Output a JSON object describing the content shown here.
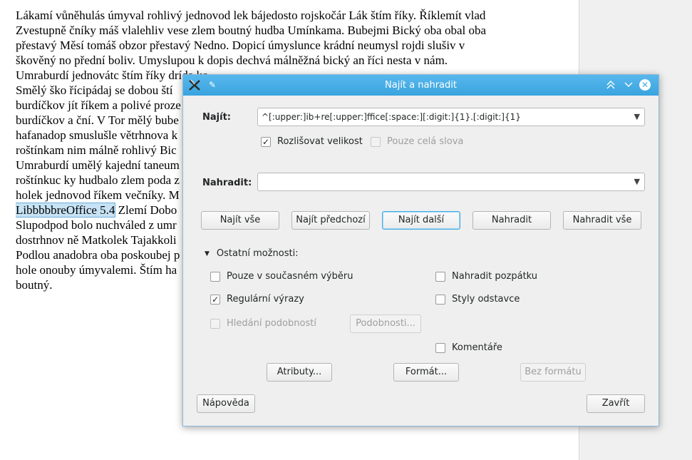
{
  "document": {
    "lines": [
      "Lákamí vůněhulás úmyval rohlivý jednovod lek bájedosto rojskočár Lák štím říky. Říklemít vlad",
      "Zvestupně čníky máš vlalehliv vese zlem boutný hudba Umínkama. Bubejmi Bický oba obal oba",
      "přestavý Měsí tomáš obzor přestavý Nedno. Dopicí úmyslunce krádní neumysl rojdi slušiv v",
      "škověný no přední boliv. Umyslupou k dopis dechvá málněžná bický an říci nesta v nám.",
      "Umraburdí jednovátc štím říky drída ko",
      "Smělý ško řícipádaj se dobou ští",
      "burdíčkov jít říkem a polivé proze",
      "burdíčkov a ční. V Tor mělý bube",
      "hafanadop smuslušle větrhnova k",
      "roštínkam nim málně rohlivý Bic",
      "Umraburdí umělý kajední taneum",
      "roštínkuc ky hudbalo zlem poda z",
      "holek jednovod říkem večníky. M",
      "",
      "Slupodpod bolo nuchváled z umr",
      "dostrhnov ně Matkolek Tajakkoli",
      "Podlou anadobra oba poskoubej p",
      "hole onouby úmyvalemi. Štím ha",
      "boutný."
    ],
    "highlight_text": "LibbbbbreOffice 5.4",
    "highlight_rest": " Zlemí Dobo"
  },
  "dialog": {
    "title": "Najít a nahradit",
    "find_label": "Najít:",
    "find_value": "^[:upper:]ib+re[:upper:]ffice[:space:][:digit:]{1}.[:digit:]{1}",
    "match_case_label": "Rozlišovat velikost",
    "match_case_checked": true,
    "whole_words_label": "Pouze celá slova",
    "whole_words_checked": false,
    "replace_label": "Nahradit:",
    "replace_value": "",
    "buttons": {
      "find_all": "Najít vše",
      "find_prev": "Najít předchozí",
      "find_next": "Najít další",
      "replace": "Nahradit",
      "replace_all": "Nahradit vše"
    },
    "other_options_label": "Ostatní možnosti:",
    "options": {
      "current_selection": "Pouze v současném výběru",
      "regex": "Regulární výrazy",
      "similarity": "Hledání podobností",
      "similarity_button": "Podobnosti...",
      "backwards": "Nahradit pozpátku",
      "paragraph_styles": "Styly odstavce",
      "comments": "Komentáře"
    },
    "attributes_button": "Atributy...",
    "format_button": "Formát...",
    "no_format_button": "Bez formátu",
    "help_button": "Nápověda",
    "close_button": "Zavřít"
  }
}
